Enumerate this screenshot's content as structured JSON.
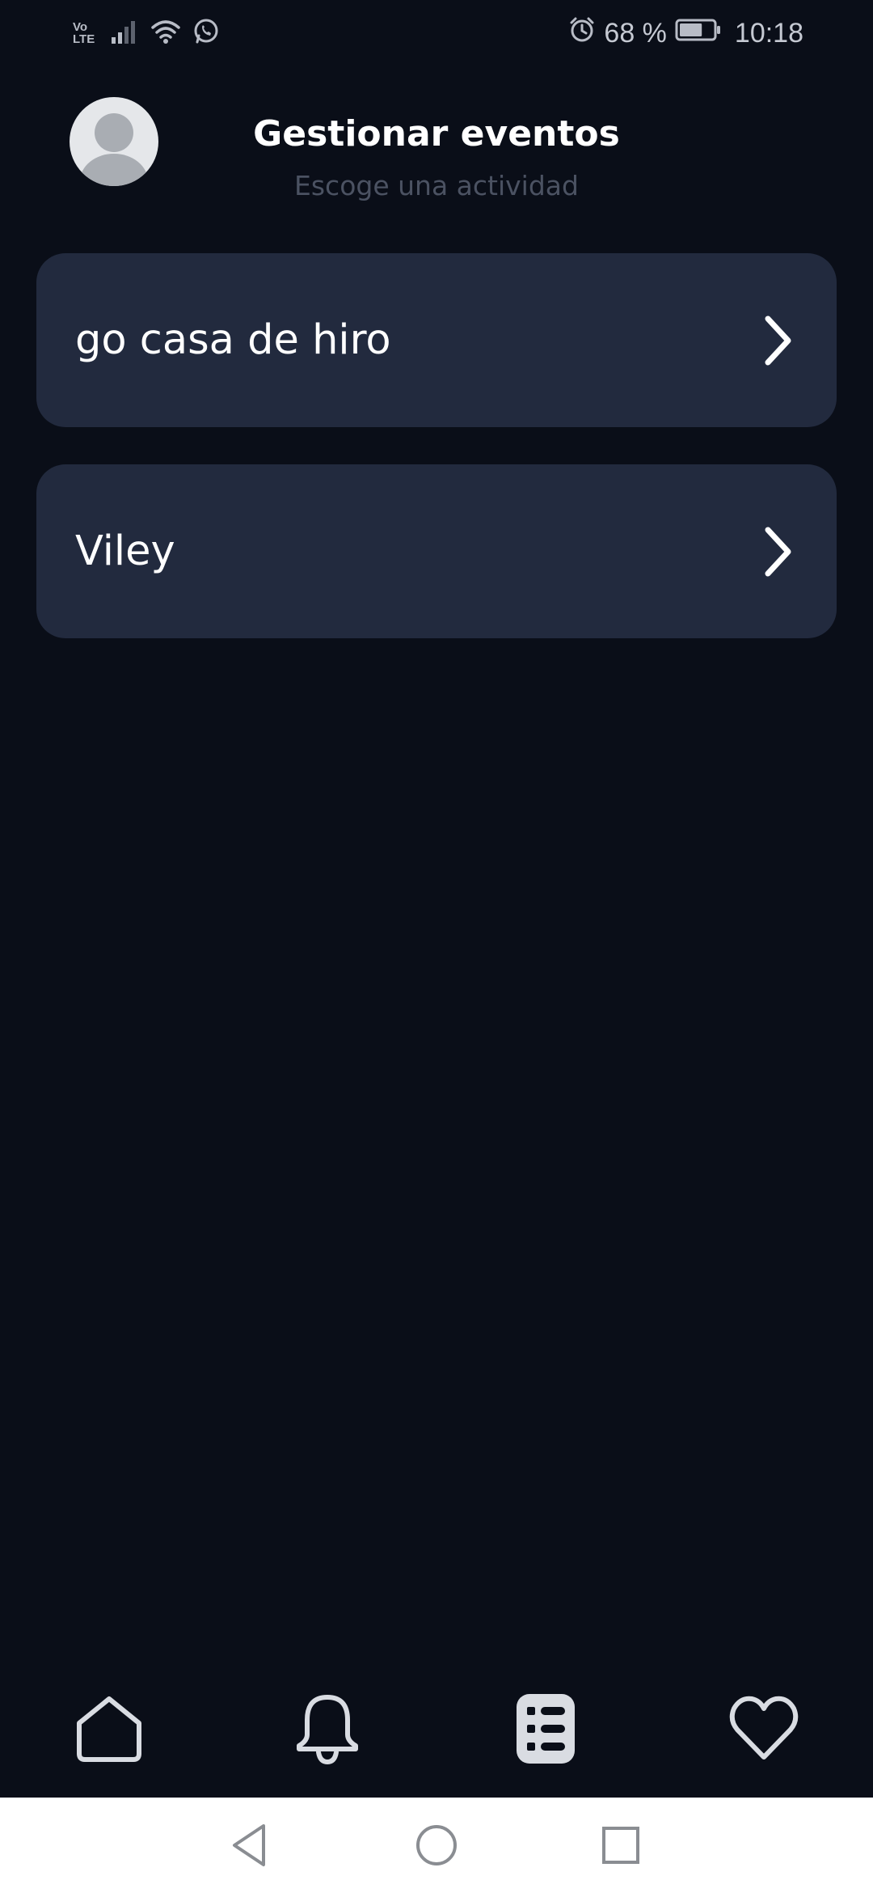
{
  "status_bar": {
    "volte_top": "Vo",
    "volte_bottom": "LTE",
    "battery_percent": "68 %",
    "time": "10:18",
    "battery_level": 0.68
  },
  "header": {
    "title": "Gestionar eventos",
    "subtitle": "Escoge una actividad"
  },
  "events": [
    {
      "label": "go casa de hiro"
    },
    {
      "label": "Viley"
    }
  ],
  "bottom_nav": {
    "items": [
      {
        "icon": "home-icon"
      },
      {
        "icon": "bell-icon"
      },
      {
        "icon": "list-icon",
        "active": true
      },
      {
        "icon": "heart-icon"
      }
    ]
  },
  "colors": {
    "background": "#0a0e18",
    "card": "#222a3e",
    "text_primary": "#ffffff",
    "text_secondary": "#4b5262",
    "icon": "#d9dce2"
  }
}
